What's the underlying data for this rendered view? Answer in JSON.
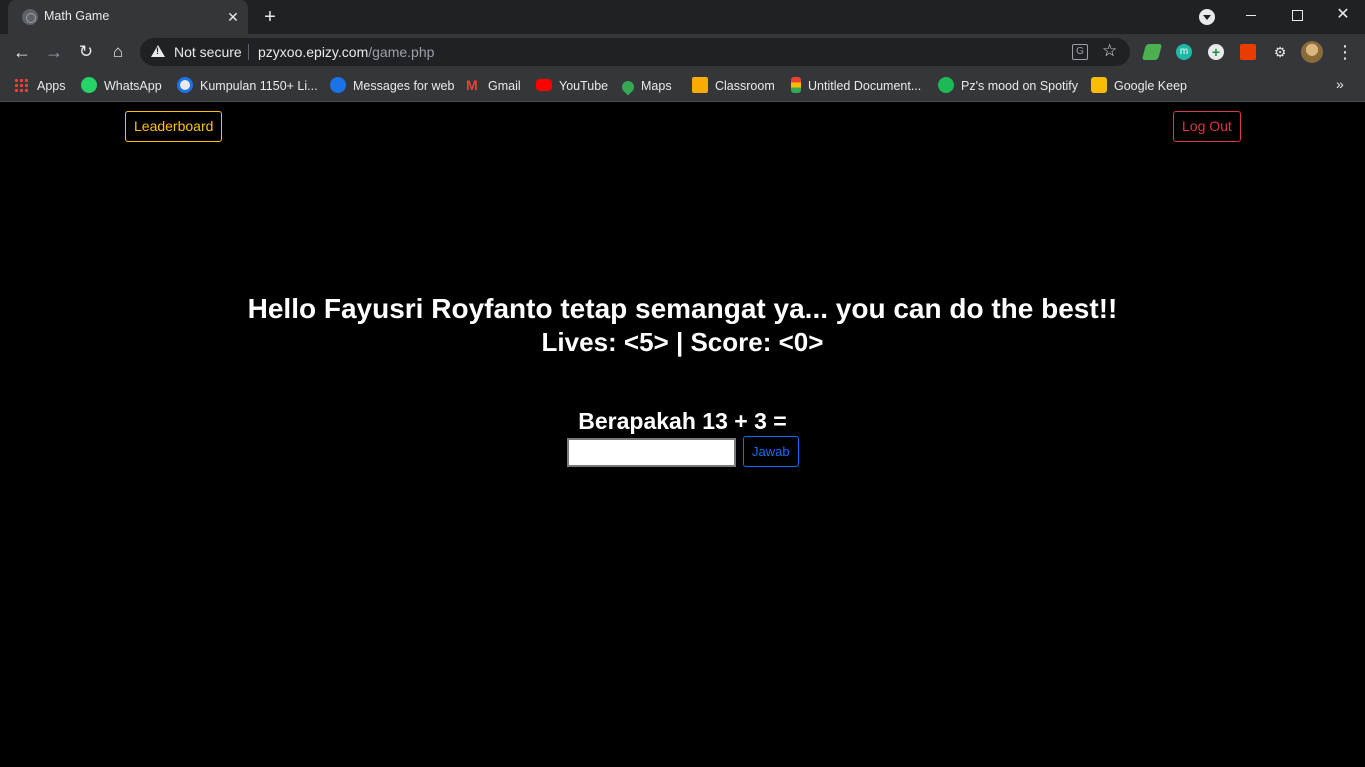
{
  "browser": {
    "tab": {
      "title": "Math Game",
      "close": "✕"
    },
    "new_tab": "+",
    "window": {
      "close": "✕"
    },
    "address": {
      "security": "Not secure",
      "url_host": "pzyxoo.epizy.com",
      "url_path": "/game.php"
    },
    "bookmarks": [
      {
        "label": "Apps",
        "icon": "apps-grid-icon"
      },
      {
        "label": "WhatsApp",
        "icon": "whatsapp-icon"
      },
      {
        "label": "Kumpulan 1150+ Li...",
        "icon": "kumpulan-icon"
      },
      {
        "label": "Messages for web",
        "icon": "messages-icon"
      },
      {
        "label": "Gmail",
        "icon": "gmail-icon"
      },
      {
        "label": "YouTube",
        "icon": "youtube-icon"
      },
      {
        "label": "Maps",
        "icon": "maps-icon"
      },
      {
        "label": "Classroom",
        "icon": "classroom-icon"
      },
      {
        "label": "Untitled Document...",
        "icon": "docs-icon"
      },
      {
        "label": "Pz's mood on Spotify",
        "icon": "spotify-icon"
      },
      {
        "label": "Google Keep",
        "icon": "keep-icon"
      }
    ],
    "bookmarks_more": "»"
  },
  "page": {
    "leaderboard_label": "Leaderboard",
    "logout_label": "Log Out",
    "greeting": "Hello Fayusri Royfanto tetap semangat ya... you can do the best!!",
    "stats": "Lives: <5> | Score: <0>",
    "question": "Berapakah 13 + 3 =",
    "answer_value": "",
    "submit_label": "Jawab"
  },
  "colors": {
    "leaderboard": "#ffc107",
    "logout": "#dc3545",
    "submit": "#0d6efd",
    "page_bg": "#000000"
  }
}
